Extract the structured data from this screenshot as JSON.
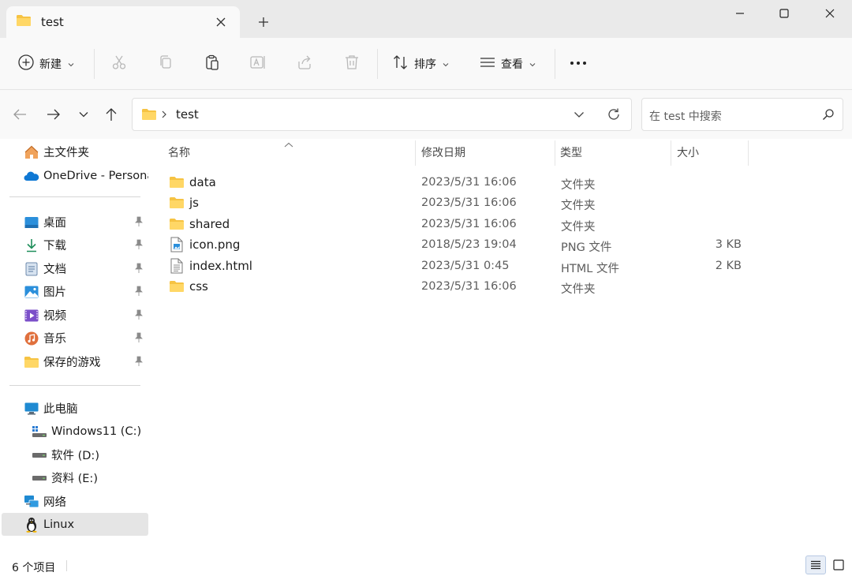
{
  "window": {
    "tab_title": "test",
    "tab_close_icon": "close-icon",
    "new_tab_icon": "plus-icon",
    "minimize_icon": "minimize-icon",
    "maximize_icon": "maximize-icon",
    "close_icon": "close-icon"
  },
  "toolbar": {
    "new_label": "新建",
    "sort_label": "排序",
    "view_label": "查看",
    "more_label": "···",
    "icons": [
      "cut-icon",
      "copy-icon",
      "paste-icon",
      "rename-icon",
      "share-icon",
      "delete-icon"
    ]
  },
  "address": {
    "path": "test",
    "search_placeholder": "在 test 中搜索"
  },
  "sidebar": {
    "items": [
      {
        "label": "主文件夹",
        "icon": "home-icon",
        "pinned": false
      },
      {
        "label": "OneDrive - Persona",
        "icon": "onedrive-icon",
        "pinned": false
      },
      {
        "label": "桌面",
        "icon": "desktop-icon",
        "pinned": true
      },
      {
        "label": "下载",
        "icon": "download-icon",
        "pinned": true
      },
      {
        "label": "文档",
        "icon": "documents-icon",
        "pinned": true
      },
      {
        "label": "图片",
        "icon": "pictures-icon",
        "pinned": true
      },
      {
        "label": "视频",
        "icon": "videos-icon",
        "pinned": true
      },
      {
        "label": "音乐",
        "icon": "music-icon",
        "pinned": true
      },
      {
        "label": "保存的游戏",
        "icon": "folder-icon",
        "pinned": true
      },
      {
        "label": "此电脑",
        "icon": "this-pc-icon",
        "pinned": false
      },
      {
        "label": "Windows11 (C:)",
        "icon": "windows-drive-icon",
        "pinned": false
      },
      {
        "label": "软件 (D:)",
        "icon": "drive-icon",
        "pinned": false
      },
      {
        "label": "资料 (E:)",
        "icon": "drive-icon",
        "pinned": false
      },
      {
        "label": "网络",
        "icon": "network-icon",
        "pinned": false
      },
      {
        "label": "Linux",
        "icon": "linux-icon",
        "pinned": false,
        "selected": true
      }
    ]
  },
  "columns": {
    "name": "名称",
    "modified": "修改日期",
    "type": "类型",
    "size": "大小"
  },
  "files": [
    {
      "name": "data",
      "modified": "2023/5/31 16:06",
      "type": "文件夹",
      "size": "",
      "icon": "folder-icon"
    },
    {
      "name": "js",
      "modified": "2023/5/31 16:06",
      "type": "文件夹",
      "size": "",
      "icon": "folder-icon"
    },
    {
      "name": "shared",
      "modified": "2023/5/31 16:06",
      "type": "文件夹",
      "size": "",
      "icon": "folder-icon"
    },
    {
      "name": "icon.png",
      "modified": "2018/5/23 19:04",
      "type": "PNG 文件",
      "size": "3 KB",
      "icon": "image-file-icon"
    },
    {
      "name": "index.html",
      "modified": "2023/5/31 0:45",
      "type": "HTML 文件",
      "size": "2 KB",
      "icon": "text-file-icon"
    },
    {
      "name": "css",
      "modified": "2023/5/31 16:06",
      "type": "文件夹",
      "size": "",
      "icon": "folder-icon"
    }
  ],
  "status": {
    "item_count": "6 个项目"
  },
  "colors": {
    "folder": "#f6c343",
    "accent": "#0067c0",
    "selected_bg": "#e5e5e5"
  }
}
